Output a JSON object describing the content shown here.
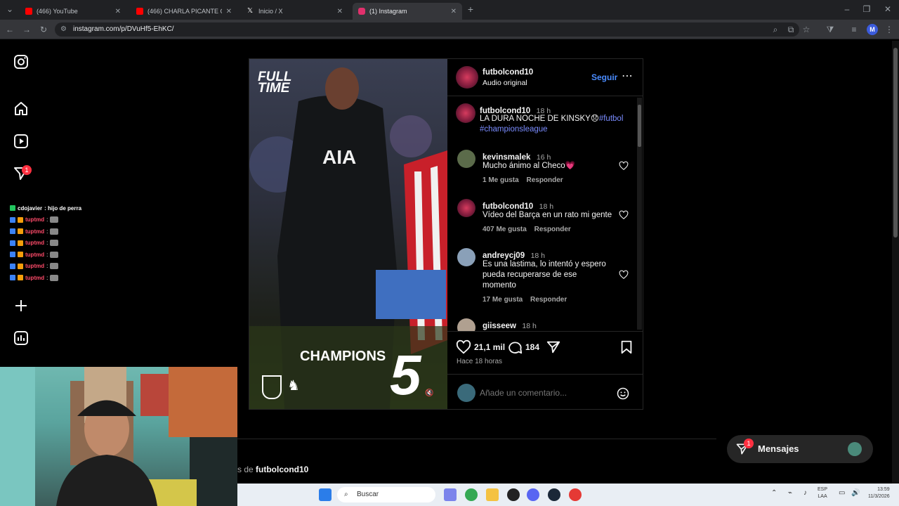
{
  "browser": {
    "tabs": [
      {
        "title": "(466) YouTube",
        "color": "#ff0000"
      },
      {
        "title": "(466) CHARLA PICANTE CON C",
        "color": "#ff0000"
      },
      {
        "title": "Inicio / X",
        "color": "#ffffff"
      },
      {
        "title": "(1) Instagram",
        "color": "#e1306c"
      }
    ],
    "url": "instagram.com/p/DVuHf5-EhKC/",
    "profile_initial": "M"
  },
  "sidebar": {
    "notification_count": "1"
  },
  "chat": [
    {
      "user": "cdojavier",
      "msg": ": hijo de perra",
      "white": true
    },
    {
      "user": "tuptmd",
      "msg": ":"
    },
    {
      "user": "tuptmd",
      "msg": ":"
    },
    {
      "user": "tuptmd",
      "msg": ":"
    },
    {
      "user": "tuptmd",
      "msg": ":"
    },
    {
      "user": "tuptmd",
      "msg": ":"
    },
    {
      "user": "tuptmd",
      "msg": ":"
    }
  ],
  "post": {
    "image": {
      "fulltime": "FULL TIME",
      "jersey": "AIA",
      "champions": "CHAMPIONS",
      "score": "5"
    },
    "header": {
      "username": "futbolcond10",
      "subtitle": "Audio original",
      "follow": "Seguir"
    },
    "caption": {
      "username": "futbolcond10",
      "time": "18 h",
      "text": "LA DURA NOCHE DE KINSKY😞",
      "tag1": "#futbol",
      "tag2": "#championsleague"
    },
    "comments": [
      {
        "user": "kevinsmalek",
        "time": "16 h",
        "lines": [
          "Mucho ánimo al Checo💗"
        ],
        "likes": "1 Me gusta",
        "reply": "Responder"
      },
      {
        "user": "futbolcond10",
        "time": "18 h",
        "lines": [
          "Vídeo del Barça en un rato mi gente"
        ],
        "likes": "407 Me gusta",
        "reply": "Responder"
      },
      {
        "user": "andreycj09",
        "time": "18 h",
        "lines": [
          "Es una lastima, lo intentó y espero",
          "pueda recuperarse de ese",
          "momento"
        ],
        "likes": "17 Me gusta",
        "reply": "Responder"
      },
      {
        "user": "giisseew",
        "time": "18 h",
        "lines": [],
        "likes": "",
        "reply": ""
      }
    ],
    "actions": {
      "likes": "21,1 mil",
      "comments": "184",
      "posted": "Hace 18 horas"
    },
    "comment_placeholder": "Añade un comentario..."
  },
  "below": {
    "more_from": "s de",
    "username": "futbolcond10"
  },
  "mensajes": {
    "label": "Mensajes",
    "count": "1"
  },
  "taskbar": {
    "search": "Buscar",
    "lang1": "ESP",
    "lang2": "LAA",
    "time": "13:59",
    "date": "11/3/2026"
  }
}
